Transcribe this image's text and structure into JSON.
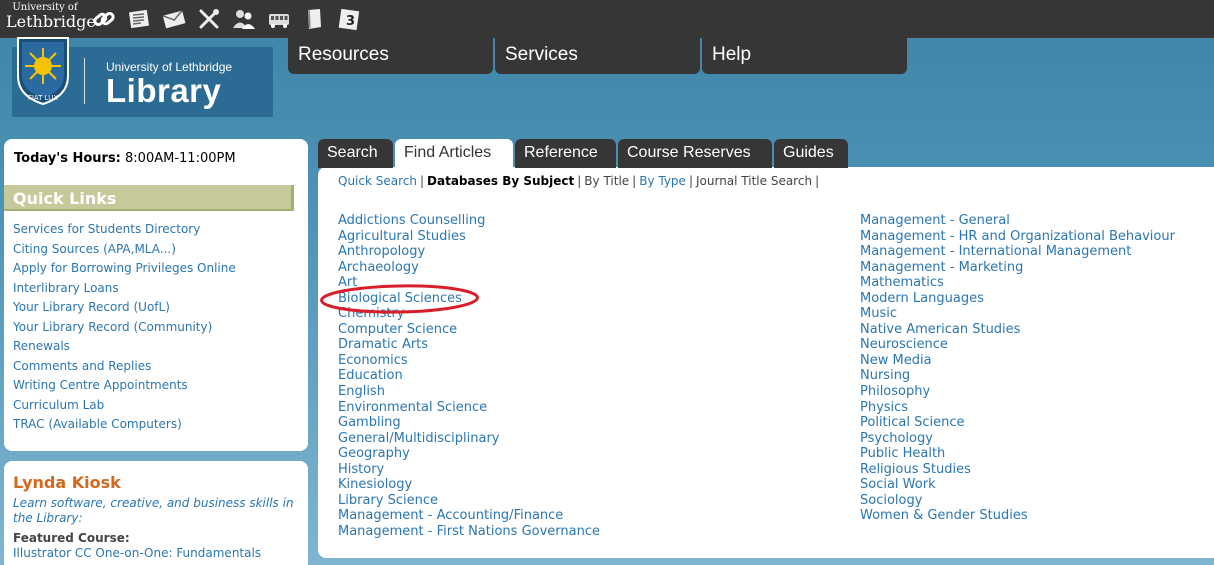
{
  "topbar": {
    "university_small": "University of",
    "university_big": "Lethbridge",
    "icons": [
      "link-icon",
      "newspaper-icon",
      "mail-icon",
      "tools-icon",
      "people-icon",
      "bus-icon",
      "book-icon",
      "calendar-icon"
    ],
    "calendar_day": "3"
  },
  "logo": {
    "shield_motto": "FIAT LUX",
    "university": "University of Lethbridge",
    "library": "Library"
  },
  "mainnav": {
    "resources": "Resources",
    "services": "Services",
    "help": "Help"
  },
  "hours": {
    "label": "Today's Hours:",
    "value": "8:00AM-11:00PM"
  },
  "quicklinks": {
    "title": "Quick Links",
    "items": [
      "Services for Students Directory",
      "Citing Sources (APA,MLA...)",
      "Apply for Borrowing Privileges Online",
      "Interlibrary Loans",
      "Your Library Record (UofL)",
      "Your Library Record (Community)",
      "Renewals",
      "Comments and Replies",
      "Writing Centre Appointments",
      "Curriculum Lab",
      "TRAC (Available Computers)"
    ]
  },
  "kiosk": {
    "title": "Lynda Kiosk",
    "description": "Learn software, creative, and business skills in the Library:",
    "featured_label": "Featured Course:",
    "course": "Illustrator CC One-on-One: Fundamentals"
  },
  "tabs": [
    "Search",
    "Find Articles",
    "Reference",
    "Course Reserves",
    "Guides"
  ],
  "active_tab": "Find Articles",
  "subnav": {
    "quick_search": "Quick Search",
    "databases_by_subject": "Databases By Subject",
    "by_title": "By Title",
    "by_type": "By Type",
    "journal_title_search": "Journal Title Search",
    "separator": "|"
  },
  "subjects_col1": [
    "Addictions Counselling",
    "Agricultural Studies",
    "Anthropology",
    "Archaeology",
    "Art",
    "Biological Sciences",
    "Chemistry",
    "Computer Science",
    "Dramatic Arts",
    "Economics",
    "Education",
    "English",
    "Environmental Science",
    "Gambling",
    "General/Multidisciplinary",
    "Geography",
    "History",
    "Kinesiology",
    "Library Science",
    "Management - Accounting/Finance",
    "Management - First Nations Governance"
  ],
  "subjects_col2": [
    "Management - General",
    "Management - HR and Organizational Behaviour",
    "Management - International Management",
    "Management - Marketing",
    "Mathematics",
    "Modern Languages",
    "Music",
    "Native American Studies",
    "Neuroscience",
    "New Media",
    "Nursing",
    "Philosophy",
    "Physics",
    "Political Science",
    "Psychology",
    "Public Health",
    "Religious Studies",
    "Social Work",
    "Sociology",
    "Women & Gender Studies"
  ],
  "highlight": {
    "circled_item": "Biological Sciences",
    "color": "#d81e2a"
  },
  "colors": {
    "link": "#2b76b0",
    "dark": "#363636",
    "quicklinks_header": "#c6c99a",
    "kiosk_title": "#d2691e"
  }
}
